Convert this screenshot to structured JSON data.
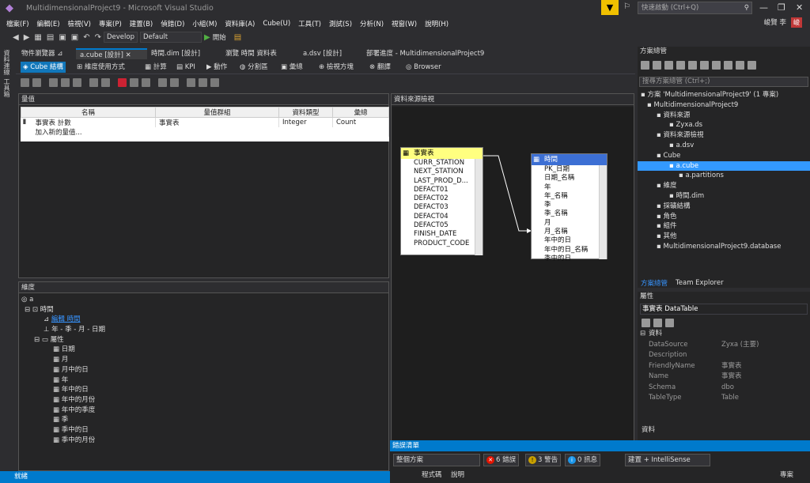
{
  "window": {
    "title": "MultidimensionalProject9 - Microsoft Visual Studio",
    "quick_launch": "快速啟動 (Ctrl+Q)",
    "user": "峻賢 李",
    "user_initial": "峻"
  },
  "menu": [
    "檔案(F)",
    "編輯(E)",
    "檢視(V)",
    "專案(P)",
    "建置(B)",
    "偵錯(D)",
    "小組(M)",
    "資料庫(A)",
    "Cube(U)",
    "工具(T)",
    "測試(S)",
    "分析(N)",
    "視窗(W)",
    "說明(H)"
  ],
  "toolbar": {
    "config": "Develop",
    "platform": "Default",
    "start": "開始"
  },
  "left_strip": [
    "資料連線",
    "工具箱"
  ],
  "tabs": [
    "物件瀏覽器",
    "a.cube [設計]",
    "時間.dim [設計]",
    "瀏覽 時間 資料表",
    "a.dsv [設計]",
    "部署進度 - MultidimensionalProject9"
  ],
  "subtabs": [
    "Cube 結構",
    "維度使用方式",
    "計算",
    "KPI",
    "動作",
    "分割區",
    "彙總",
    "檢視方塊",
    "翻譯",
    "Browser"
  ],
  "measures": {
    "title": "量值",
    "columns": [
      "名稱",
      "量值群組",
      "資料類型",
      "彙總"
    ],
    "row": [
      "事實表 計數",
      "事實表",
      "Integer",
      "Count"
    ],
    "add": "加入新的量值..."
  },
  "dimensions": {
    "title": "維度",
    "root": "a",
    "time": "時間",
    "edit": "編輯 時間",
    "hierarchy": "年 - 季 - 月 - 日期",
    "attrs_label": "屬性",
    "attrs": [
      "日期",
      "月",
      "月中的日",
      "年",
      "年中的日",
      "年中的月份",
      "年中的季度",
      "季",
      "季中的日",
      "季中的月份"
    ]
  },
  "dsv": {
    "title": "資料來源檢視",
    "fact": {
      "name": "事實表",
      "cols": [
        "CURR_STATION",
        "NEXT_STATION",
        "LAST_PROD_D...",
        "DEFACT01",
        "DEFACT02",
        "DEFACT03",
        "DEFACT04",
        "DEFACT05",
        "FINISH_DATE",
        "PRODUCT_CODE"
      ]
    },
    "time": {
      "name": "時間",
      "cols": [
        "PK_日期",
        "日期_名稱",
        "年",
        "年_名稱",
        "季",
        "季_名稱",
        "月",
        "月_名稱",
        "年中的日",
        "年中的日_名稱",
        "季中的日"
      ]
    }
  },
  "solution": {
    "title": "方案總管",
    "search": "搜尋方案總管 (Ctrl+;)",
    "items": [
      "方案 'MultidimensionalProject9' (1 專案)",
      "MultidimensionalProject9",
      "資料來源",
      "Zyxa.ds",
      "資料來源檢視",
      "a.dsv",
      "Cube",
      "a.cube",
      "a.partitions",
      "維度",
      "時間.dim",
      "採礦結構",
      "角色",
      "組件",
      "其他",
      "MultidimensionalProject9.database"
    ],
    "tabs": [
      "方案總管",
      "Team Explorer"
    ]
  },
  "properties": {
    "title": "屬性",
    "object": "事實表 DataTable",
    "category": "資料",
    "rows": [
      [
        "DataSource",
        "Zyxa (主要)"
      ],
      [
        "Description",
        ""
      ],
      [
        "FriendlyName",
        "事實表"
      ],
      [
        "Name",
        "事實表"
      ],
      [
        "Schema",
        "dbo"
      ],
      [
        "TableType",
        "Table"
      ]
    ],
    "footer": "資料"
  },
  "errors": {
    "title": "錯誤清單",
    "scope": "整個方案",
    "errors": "6 錯誤",
    "warnings": "3 警告",
    "messages": "0 訊息",
    "build": "建置 + IntelliSense",
    "col_code": "程式碼",
    "col_desc": "說明",
    "col_proj": "專案"
  },
  "status": "就緒"
}
